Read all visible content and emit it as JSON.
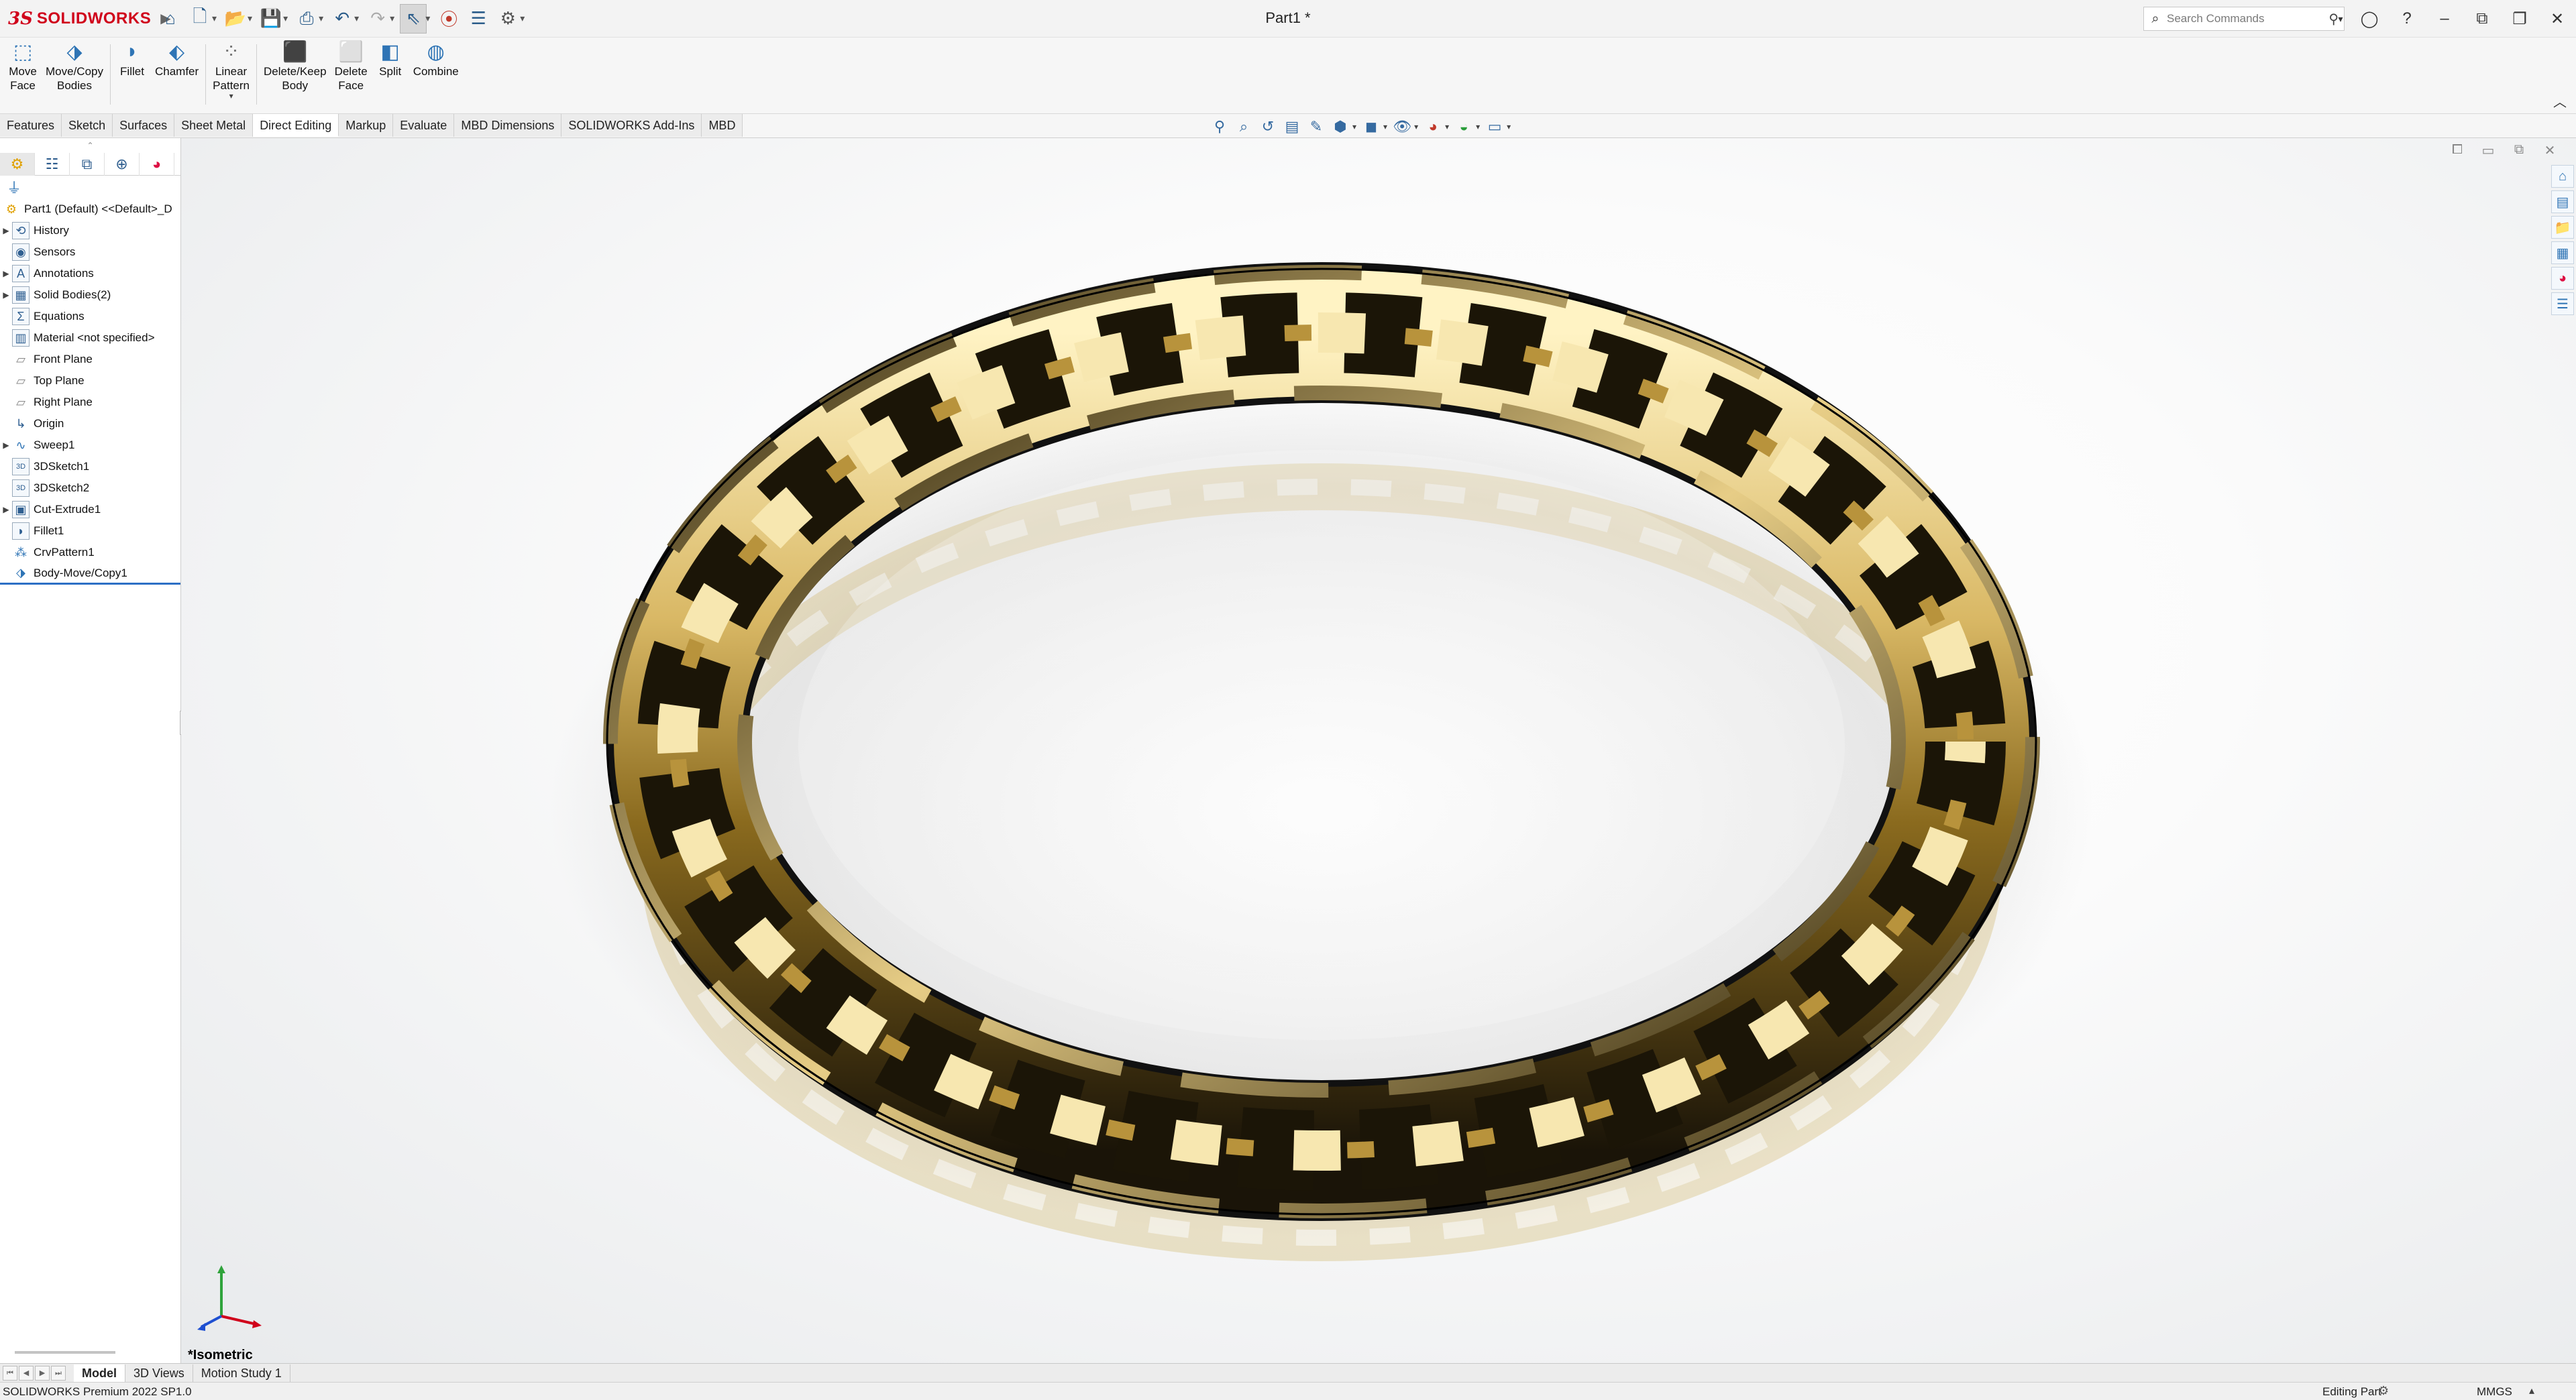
{
  "app": {
    "brand": "SOLIDWORKS",
    "window_title": "Part1 *"
  },
  "quick_access": {
    "items": [
      "home-icon",
      "new-document-icon",
      "open-folder-icon",
      "save-icon",
      "print-icon",
      "undo-icon",
      "redo-icon",
      "select-cursor-icon",
      "traffic-light-icon",
      "file-properties-icon",
      "options-gear-icon"
    ]
  },
  "search": {
    "placeholder": "Search Commands"
  },
  "ribbon": {
    "buttons": [
      {
        "label": "Move\nFace",
        "icon": "move-face-icon"
      },
      {
        "label": "Move/Copy\nBodies",
        "icon": "move-copy-bodies-icon"
      },
      {
        "label": "Fillet",
        "icon": "fillet-icon"
      },
      {
        "label": "Chamfer",
        "icon": "chamfer-icon"
      },
      {
        "label": "Linear\nPattern",
        "icon": "linear-pattern-icon"
      },
      {
        "label": "Delete/Keep\nBody",
        "icon": "delete-keep-body-icon"
      },
      {
        "label": "Delete\nFace",
        "icon": "delete-face-icon"
      },
      {
        "label": "Split",
        "icon": "split-icon"
      },
      {
        "label": "Combine",
        "icon": "combine-icon"
      }
    ]
  },
  "tabs": [
    "Features",
    "Sketch",
    "Surfaces",
    "Sheet Metal",
    "Direct Editing",
    "Markup",
    "Evaluate",
    "MBD Dimensions",
    "SOLIDWORKS Add-Ins",
    "MBD"
  ],
  "active_tab": "Direct Editing",
  "feature_tree": {
    "root": "Part1 (Default) <<Default>_D",
    "items": [
      {
        "label": "History",
        "expandable": true
      },
      {
        "label": "Sensors",
        "expandable": false
      },
      {
        "label": "Annotations",
        "expandable": true
      },
      {
        "label": "Solid Bodies(2)",
        "expandable": true
      },
      {
        "label": "Equations",
        "expandable": false
      },
      {
        "label": "Material <not specified>",
        "expandable": false
      },
      {
        "label": "Front Plane",
        "expandable": false
      },
      {
        "label": "Top Plane",
        "expandable": false
      },
      {
        "label": "Right Plane",
        "expandable": false
      },
      {
        "label": "Origin",
        "expandable": false
      },
      {
        "label": "Sweep1",
        "expandable": true
      },
      {
        "label": "3DSketch1",
        "expandable": false
      },
      {
        "label": "3DSketch2",
        "expandable": false
      },
      {
        "label": "Cut-Extrude1",
        "expandable": true
      },
      {
        "label": "Fillet1",
        "expandable": false
      },
      {
        "label": "CrvPattern1",
        "expandable": false
      },
      {
        "label": "Body-Move/Copy1",
        "expandable": false
      }
    ]
  },
  "viewport": {
    "view_name": "*Isometric"
  },
  "bottom_tabs": [
    "Model",
    "3D Views",
    "Motion Study 1"
  ],
  "active_bottom_tab": "Model",
  "status": {
    "product": "SOLIDWORKS Premium 2022 SP1.0",
    "mode": "Editing Part",
    "units": "MMGS"
  },
  "colors": {
    "brand_red": "#d0021b",
    "gold": "#c9a84a",
    "accent_blue": "#2c6fc5"
  }
}
